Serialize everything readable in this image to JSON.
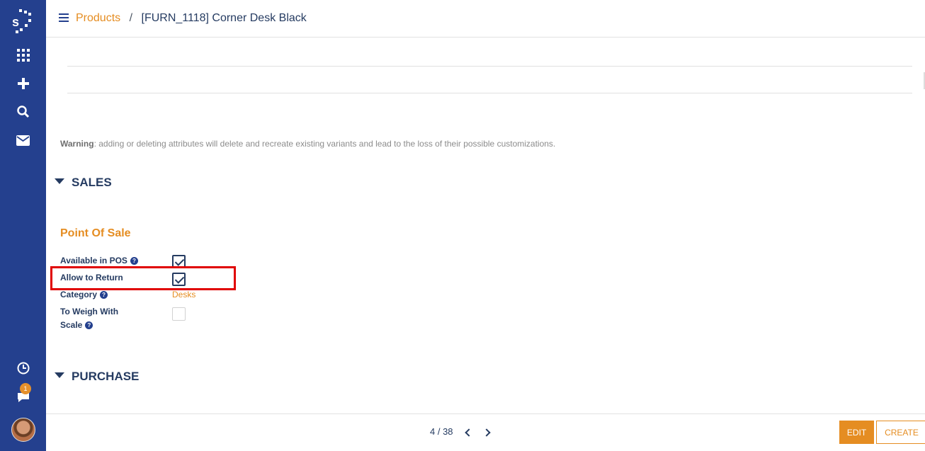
{
  "header": {
    "breadcrumb_root": "Products",
    "breadcrumb_separator": "/",
    "breadcrumb_current": "[FURN_1118] Corner Desk Black"
  },
  "sidebar": {
    "notification_count": "1",
    "icons": [
      "logo-icon",
      "apps-icon",
      "plus-icon",
      "search-icon",
      "mail-icon",
      "clock-icon",
      "chat-icon",
      "avatar"
    ]
  },
  "content": {
    "warning_label": "Warning",
    "warning_text": ": adding or deleting attributes will delete and recreate existing variants and lead to the loss of their possible customizations.",
    "sales_title": "SALES",
    "pos_title": "Point Of Sale",
    "fields": {
      "available_in_pos": "Available in POS",
      "allow_to_return": "Allow to Return",
      "category": "Category",
      "category_value": "Desks",
      "to_weigh_with_scale_line1": "To Weigh With",
      "to_weigh_with_scale_line2": "Scale"
    },
    "purchase_title": "PURCHASE"
  },
  "footer": {
    "pager": "4 / 38",
    "edit_label": "EDIT",
    "create_label": "CREATE"
  },
  "colors": {
    "sidebar": "#24408e",
    "accent": "#e58d22",
    "text": "#253b61",
    "highlight": "#e00000"
  }
}
